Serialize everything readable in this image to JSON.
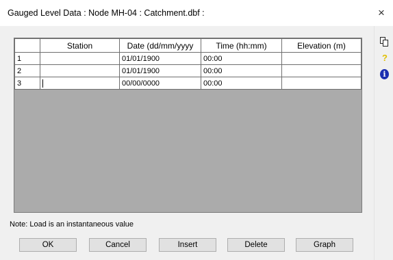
{
  "window": {
    "title": "Gauged Level Data : Node MH-04 : Catchment.dbf :",
    "close_glyph": "×"
  },
  "sidebar": {
    "icons": [
      "copy-icon",
      "help-icon",
      "info-icon"
    ],
    "help_glyph": "?",
    "info_glyph": "i"
  },
  "grid": {
    "columns": [
      "",
      "Station",
      "Date (dd/mm/yyyy",
      "Time (hh:mm)",
      "Elevation (m)"
    ],
    "rows": [
      {
        "num": "1",
        "station": "",
        "date": "01/01/1900",
        "time": "00:00",
        "elevation": ""
      },
      {
        "num": "2",
        "station": "",
        "date": "01/01/1900",
        "time": "00:00",
        "elevation": ""
      },
      {
        "num": "3",
        "station": "",
        "date": "00/00/0000",
        "time": "00:00",
        "elevation": ""
      }
    ]
  },
  "note": "Note: Load is an instantaneous value",
  "buttons": {
    "ok": "OK",
    "cancel": "Cancel",
    "insert": "Insert",
    "delete": "Delete",
    "graph": "Graph"
  },
  "colors": {
    "info_icon": "#1b2fb0",
    "help_icon": "#e0c000",
    "grid_empty_area": "#ababab"
  }
}
